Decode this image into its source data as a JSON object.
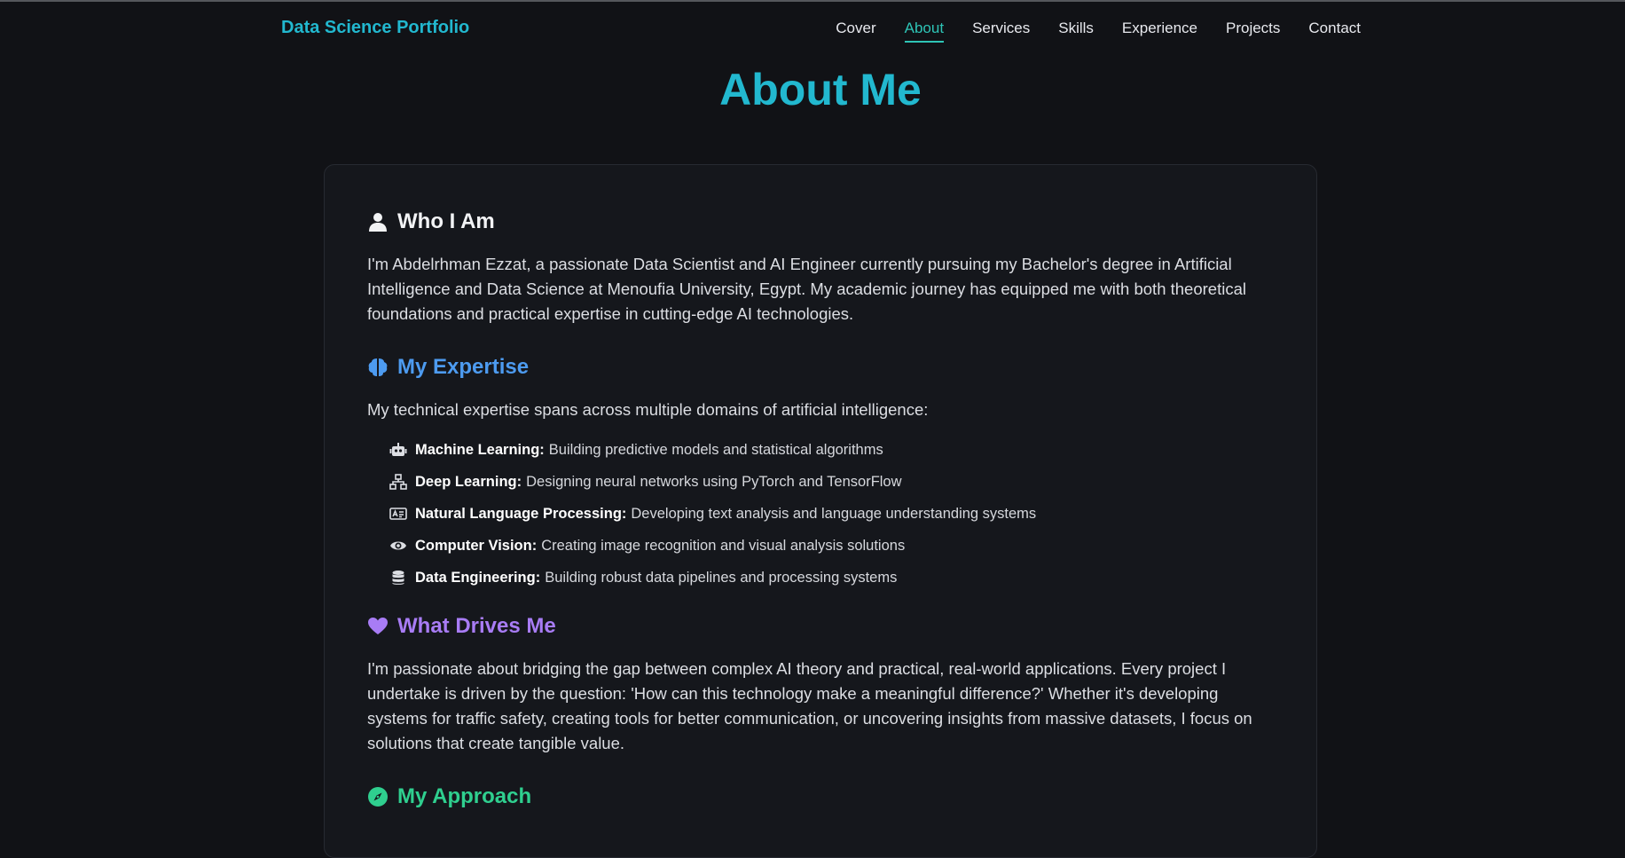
{
  "header": {
    "brand": "Data Science Portfolio",
    "nav": [
      "Cover",
      "About",
      "Services",
      "Skills",
      "Experience",
      "Projects",
      "Contact"
    ],
    "active_nav": "About"
  },
  "page_title": "About Me",
  "who": {
    "heading": "Who I Am",
    "icon": "user-icon",
    "text": "I'm Abdelrhman Ezzat, a passionate Data Scientist and AI Engineer currently pursuing my Bachelor's degree in Artificial Intelligence and Data Science at Menoufia University, Egypt. My academic journey has equipped me with both theoretical foundations and practical expertise in cutting-edge AI technologies."
  },
  "expertise": {
    "heading": "My Expertise",
    "icon": "brain-icon",
    "intro": "My technical expertise spans across multiple domains of artificial intelligence:",
    "items": [
      {
        "icon": "robot-icon",
        "title": "Machine Learning:",
        "desc": "Building predictive models and statistical algorithms"
      },
      {
        "icon": "network-icon",
        "title": "Deep Learning:",
        "desc": "Designing neural networks using PyTorch and TensorFlow"
      },
      {
        "icon": "language-icon",
        "title": "Natural Language Processing:",
        "desc": "Developing text analysis and language understanding systems"
      },
      {
        "icon": "eye-icon",
        "title": "Computer Vision:",
        "desc": "Creating image recognition and visual analysis solutions"
      },
      {
        "icon": "database-icon",
        "title": "Data Engineering:",
        "desc": "Building robust data pipelines and processing systems"
      }
    ]
  },
  "drives": {
    "heading": "What Drives Me",
    "icon": "heart-icon",
    "text": "I'm passionate about bridging the gap between complex AI theory and practical, real-world applications. Every project I undertake is driven by the question: 'How can this technology make a meaningful difference?' Whether it's developing systems for traffic safety, creating tools for better communication, or uncovering insights from massive datasets, I focus on solutions that create tangible value."
  },
  "approach": {
    "heading": "My Approach",
    "icon": "compass-icon"
  },
  "colors": {
    "accent_cyan": "#22b8cf",
    "nav_active": "#2ec4b6",
    "expertise_blue": "#4d9bf0",
    "drives_purple": "#a87cf5",
    "approach_green": "#2fcf8f",
    "background": "#111216",
    "card": "#15171c"
  }
}
